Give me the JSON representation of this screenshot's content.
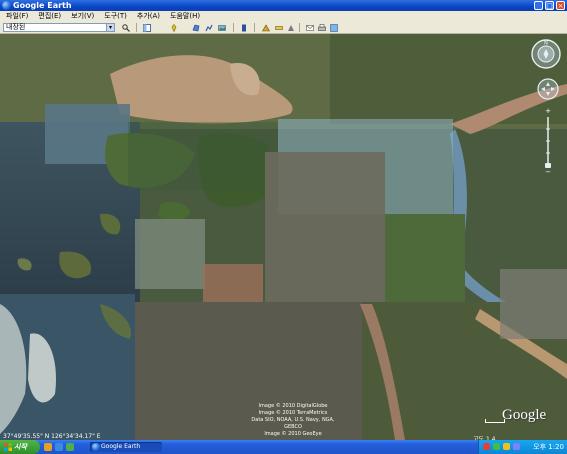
{
  "window": {
    "title": "Google Earth",
    "controls": [
      "minimize",
      "maximize",
      "close"
    ]
  },
  "menu": [
    "파일(F)",
    "편집(E)",
    "보기(V)",
    "도구(T)",
    "추가(A)",
    "도움말(H)"
  ],
  "toolbar": {
    "search_value": "내장된",
    "buttons": [
      "search-icon",
      "sidebar-icon",
      "placemark-icon",
      "polygon-icon",
      "path-icon",
      "image-overlay-icon",
      "record-tour-icon",
      "sky-icon",
      "ruler-icon",
      "email-icon",
      "print-icon",
      "maps-icon"
    ]
  },
  "map": {
    "copyright_lines": [
      "Image © 2010 DigitalGlobe",
      "Image © 2010 TerraMetrics",
      "Data SIO, NOAA, U.S. Navy, NGA, GEBCO",
      "Image © 2010 GeoEye"
    ],
    "coordinates": "37°49'35.55\" N  126°34'34.17\" E",
    "elevation_readout": "고도 1.4",
    "logo": "Google"
  },
  "taskbar": {
    "start_label": "시작",
    "task_label": "Google Earth",
    "clock": "오후 1:20"
  }
}
